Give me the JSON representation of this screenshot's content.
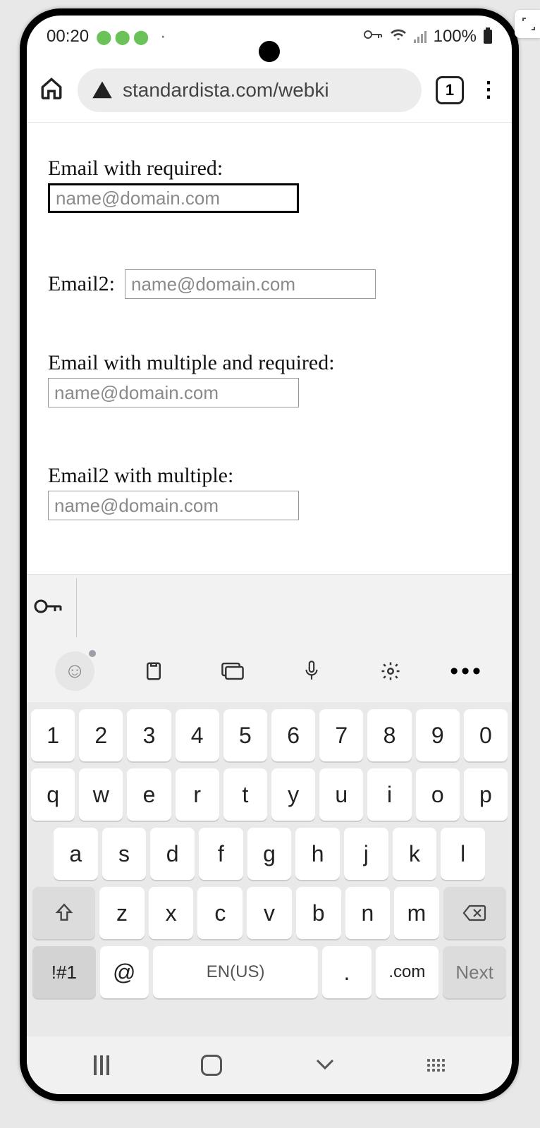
{
  "status": {
    "time": "00:20",
    "battery_text": "100%"
  },
  "browser": {
    "url": "standardista.com/webki",
    "tab_count": "1"
  },
  "form": {
    "f1": {
      "label": "Email with required:",
      "placeholder": "name@domain.com"
    },
    "f2": {
      "label": "Email2:",
      "placeholder": "name@domain.com"
    },
    "f3": {
      "label": "Email with multiple and required:",
      "placeholder": "name@domain.com"
    },
    "f4": {
      "label": "Email2 with multiple:",
      "placeholder": "name@domain.com"
    }
  },
  "keyboard": {
    "row1": [
      "1",
      "2",
      "3",
      "4",
      "5",
      "6",
      "7",
      "8",
      "9",
      "0"
    ],
    "row2": [
      "q",
      "w",
      "e",
      "r",
      "t",
      "y",
      "u",
      "i",
      "o",
      "p"
    ],
    "row3": [
      "a",
      "s",
      "d",
      "f",
      "g",
      "h",
      "j",
      "k",
      "l"
    ],
    "row4": [
      "z",
      "x",
      "c",
      "v",
      "b",
      "n",
      "m"
    ],
    "sym": "!#1",
    "at": "@",
    "space": "EN(US)",
    "period": ".",
    "com": ".com",
    "next": "Next"
  }
}
